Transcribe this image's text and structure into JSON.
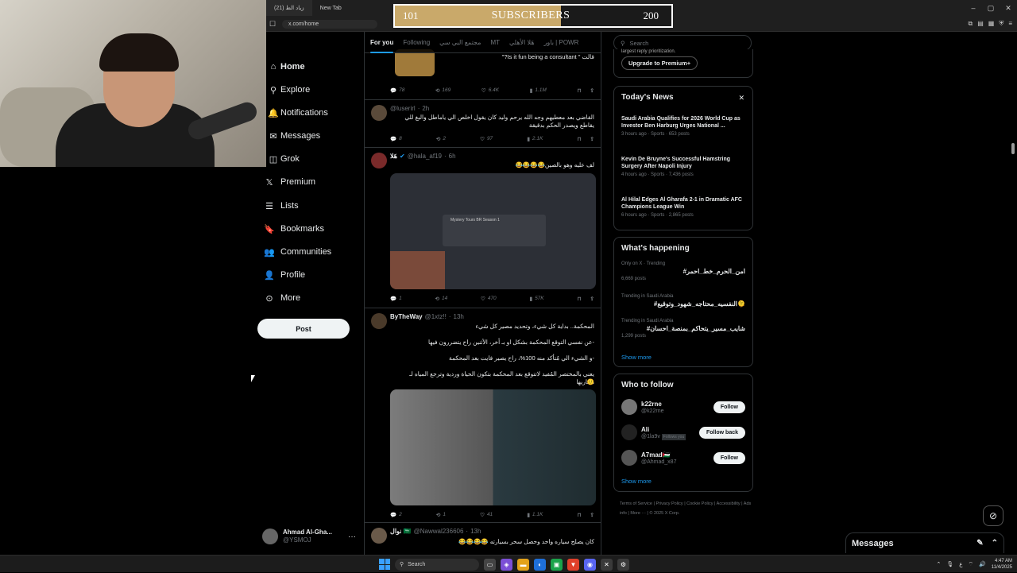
{
  "browser": {
    "tabs": [
      "(21) زياد الط",
      "New Tab"
    ],
    "url": "x.com/home"
  },
  "subscribers": {
    "current": "101",
    "label": "SUBSCRIBERS",
    "goal": "200",
    "fill_fraction": 0.6
  },
  "sidebar": {
    "items": [
      {
        "label": "Home",
        "icon": "home-icon"
      },
      {
        "label": "Explore",
        "icon": "search-icon"
      },
      {
        "label": "Notifications",
        "icon": "bell-icon"
      },
      {
        "label": "Messages",
        "icon": "mail-icon"
      },
      {
        "label": "Grok",
        "icon": "grok-icon"
      },
      {
        "label": "Premium",
        "icon": "x-logo-icon"
      },
      {
        "label": "Lists",
        "icon": "list-icon"
      },
      {
        "label": "Bookmarks",
        "icon": "bookmark-icon"
      },
      {
        "label": "Communities",
        "icon": "people-icon"
      },
      {
        "label": "Profile",
        "icon": "person-icon"
      },
      {
        "label": "More",
        "icon": "more-circle-icon"
      }
    ],
    "post_label": "Post",
    "profile": {
      "name": "Ahmad Al-Gha...",
      "handle": "@YSMOJ",
      "more": "···"
    }
  },
  "feed": {
    "tabs": [
      "For you",
      "Following",
      "مجتمع البي سي",
      "MT",
      "هَلا الأهلي",
      "باور | POWR"
    ],
    "tabs_extra": "",
    "tweet0": {
      "text": "قالت \" Is it fun being a consultant?\"",
      "replies": "78",
      "reposts": "169",
      "likes": "6.4K",
      "views": "1.1M"
    },
    "tweet1": {
      "name": "",
      "handle": "@luserirl",
      "time": "2h",
      "text": "القاضي بعد معطيهم وجه الله يرحم وليد كان يقول اخلص الي ياماطل والبغ للي يقاطع ويصدر الحكم بدقيقة",
      "replies": "8",
      "reposts": "2",
      "likes": "97",
      "views": "2.1K"
    },
    "tweet2": {
      "name": "هَلا",
      "handle": "@hala_af19",
      "time": "6h",
      "text": "لف عليه وهو بالصين😂😂😂😂",
      "media_title": "Mystery Tours BR Season 1",
      "replies": "1",
      "reposts": "14",
      "likes": "470",
      "views": "57K"
    },
    "tweet3": {
      "name": "ByTheWay",
      "handle": "@1xtz!!",
      "time": "13h",
      "lines": [
        "المحكمة.. بداية كل شيء، وتحديد مصير كل شيء",
        "-عن نفسي التوقع المحكمة بشكل او بـ أخر، الأثنين راح يتضررون فيها",
        "-و الشيء الي مُتأكد منه 100%، راح يصير فايت بعد المحكمة",
        "يعني بالمختصر المُفيد لاتتوقع بعد المحكمة بتكون الحياة وردية وترجع المياه لـ مجاريها",
        "🙂"
      ],
      "replies": "2",
      "reposts": "1",
      "likes": "41",
      "views": "1.1K"
    },
    "tweet4": {
      "name": "نوال 🇸🇦",
      "handle": "@Nawwal236606",
      "time": "13h",
      "text": "كان يصلح سياره واحد وحصل سحر بسيارته 😂😂😂😂"
    }
  },
  "right": {
    "search_placeholder": "Search",
    "premium_top": "largest reply prioritization.",
    "premium_btn": "Upgrade to Premium+",
    "news": {
      "title": "Today's News",
      "close": "✕",
      "items": [
        {
          "title": "Saudi Arabia Qualifies for 2026 World Cup as Investor Ben Harburg Urges National ...",
          "meta": "3 hours ago · Sports · 653 posts"
        },
        {
          "title": "Kevin De Bruyne's Successful Hamstring Surgery After Napoli Injury",
          "meta": "4 hours ago · Sports · 7,436 posts"
        },
        {
          "title": "Al Hilal Edges Al Gharafa 2-1 in Dramatic AFC Champions League Win",
          "meta": "6 hours ago · Sports · 2,865 posts"
        }
      ]
    },
    "happening": {
      "title": "What's happening",
      "trends": [
        {
          "context": "Only on X · Trending",
          "tag": "#امن_الحرم_خط_احمر",
          "count": "6,669 posts"
        },
        {
          "context": "Trending in Saudi Arabia",
          "tag": "#النفسيه_محتاجه_شهود_وتوقيع🫠",
          "count": ""
        },
        {
          "context": "Trending in Saudi Arabia",
          "tag": "#شايب_مسير_يتحاكم_بمنصة_احسان",
          "count": "1,299 posts"
        }
      ],
      "show_more": "Show more"
    },
    "follow": {
      "title": "Who to follow",
      "users": [
        {
          "name": "k22rne",
          "handle": "@k22rne",
          "badge": "",
          "btn": "Follow"
        },
        {
          "name": "Ali",
          "handle": "@1la9v",
          "badge": "Follows you",
          "btn": "Follow back"
        },
        {
          "name": "A7mad🇵🇸",
          "handle": "@Ahmad_x87",
          "badge": "",
          "btn": "Follow"
        }
      ],
      "show_more": "Show more"
    },
    "footer": "Terms of Service | Privacy Policy | Cookie Policy | Accessibility | Ads info | More ··· | © 2025 X Corp."
  },
  "messages": {
    "title": "Messages"
  },
  "taskbar": {
    "search": "Search",
    "time": "4:47 AM",
    "date": "11/4/2025",
    "lang": "ع"
  },
  "colors": {
    "accent": "#1d9bf0",
    "sub_fill": "#c9a96a"
  }
}
